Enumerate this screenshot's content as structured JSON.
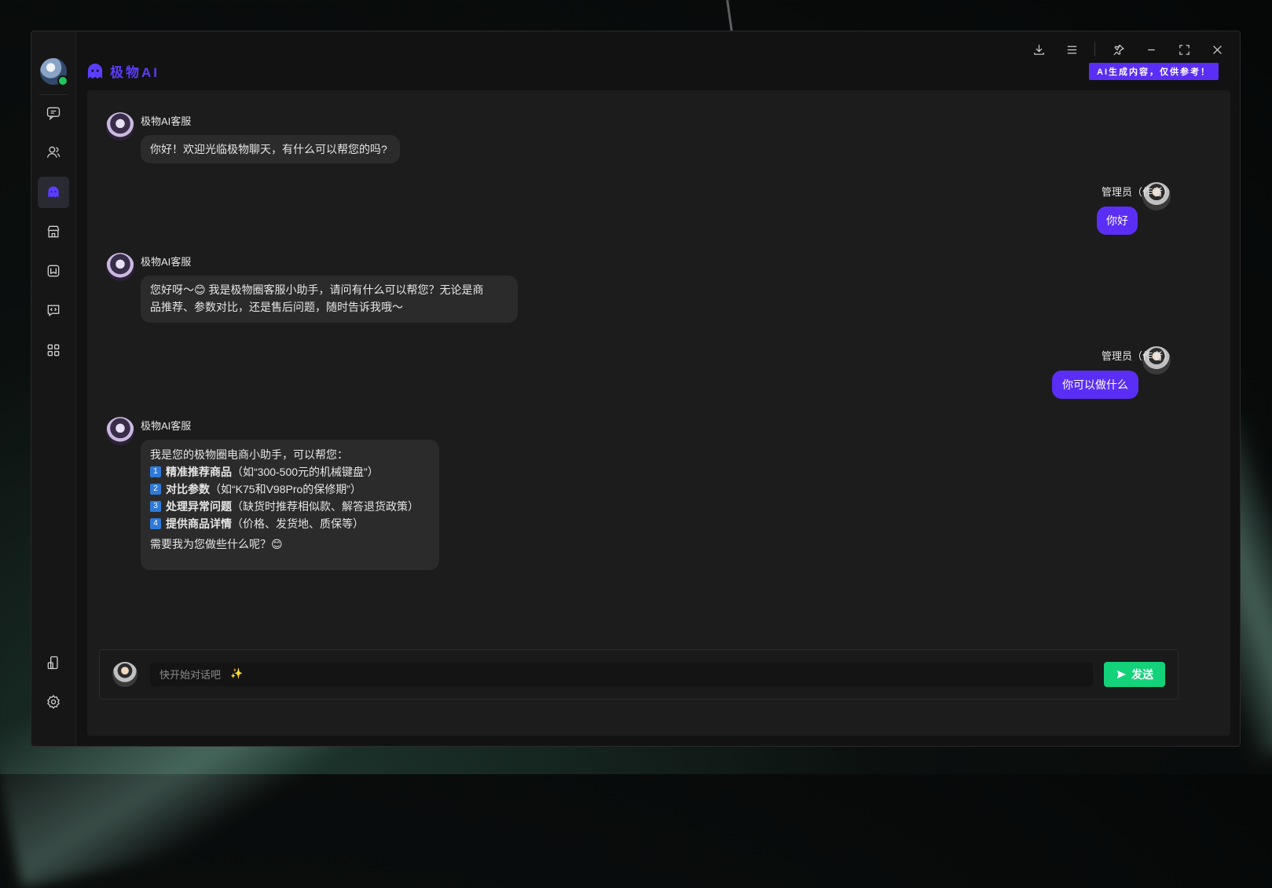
{
  "app": {
    "brand_text": "极物AI",
    "ai_badge": "AI生成内容，仅供参考！"
  },
  "sidebar": {
    "items": [
      {
        "icon": "chat-icon"
      },
      {
        "icon": "contacts-icon"
      },
      {
        "icon": "ai-ghost-icon",
        "active": true
      },
      {
        "icon": "store-icon"
      },
      {
        "icon": "book-icon"
      },
      {
        "icon": "code-chat-icon"
      },
      {
        "icon": "apps-grid-icon"
      }
    ],
    "bottom": [
      {
        "icon": "device-icon"
      },
      {
        "icon": "gear-icon"
      }
    ]
  },
  "messages": [
    {
      "from": "bot",
      "sender": "极物AI客服",
      "text": "你好！欢迎光临极物聊天，有什么可以帮您的吗?"
    },
    {
      "from": "me",
      "sender": "管理员（作者）",
      "text": "你好"
    },
    {
      "from": "bot",
      "sender": "极物AI客服",
      "line1": "您好呀～😊 我是极物圈客服小助手，请问有什么可以帮您？无论是商",
      "line2": "品推荐、参数对比，还是售后问题，随时告诉我哦～"
    },
    {
      "from": "me",
      "sender": "管理员（作者）",
      "text": "你可以做什么"
    },
    {
      "from": "bot",
      "sender": "极物AI客服",
      "intro": "我是您的极物圈电商小助手，可以帮您：",
      "items": [
        {
          "num": "1",
          "title": "精准推荐商品",
          "detail": "（如“300-500元的机械键盘”）"
        },
        {
          "num": "2",
          "title": "对比参数",
          "detail": "（如“K75和V98Pro的保修期”）"
        },
        {
          "num": "3",
          "title": "处理异常问题",
          "detail": "（缺货时推荐相似款、解答退货政策）"
        },
        {
          "num": "4",
          "title": "提供商品详情",
          "detail": "（价格、发货地、质保等）"
        }
      ],
      "outro": "需要我为您做些什么呢？😊"
    }
  ],
  "composer": {
    "placeholder": "快开始对话吧",
    "sparkle": "✨",
    "send_label": "发送"
  },
  "colors": {
    "accent": "#5b2ef5",
    "send": "#13d27a",
    "online": "#22c55e"
  }
}
